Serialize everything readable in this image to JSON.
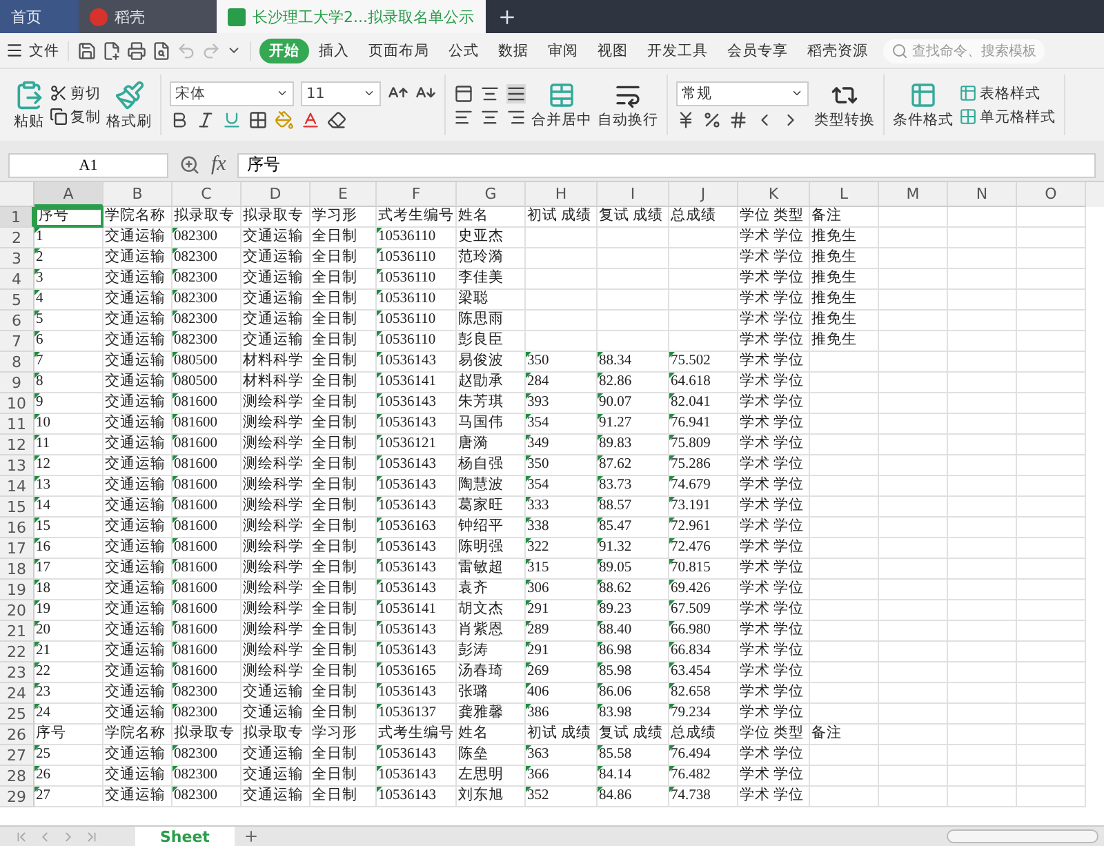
{
  "tabs": [
    {
      "label": "首页",
      "kind": "home",
      "selected": false
    },
    {
      "label": "稻壳",
      "kind": "docer",
      "selected": false
    },
    {
      "label": "长沙理工大学2...拟录取名单公示",
      "kind": "sheet",
      "selected": true
    }
  ],
  "menu": {
    "file": "文件",
    "items": [
      {
        "label": "开始",
        "selected": true
      },
      {
        "label": "插入",
        "selected": false
      },
      {
        "label": "页面布局",
        "selected": false
      },
      {
        "label": "公式",
        "selected": false
      },
      {
        "label": "数据",
        "selected": false
      },
      {
        "label": "审阅",
        "selected": false
      },
      {
        "label": "视图",
        "selected": false
      },
      {
        "label": "开发工具",
        "selected": false
      },
      {
        "label": "会员专享",
        "selected": false
      },
      {
        "label": "稻壳资源",
        "selected": false
      }
    ]
  },
  "search": {
    "placeholder": "查找命令、搜索模板"
  },
  "ribbon": {
    "paste": "粘贴",
    "cut": "剪切",
    "copy": "复制",
    "format_painter": "格式刷",
    "font_name": "宋体",
    "font_size": "11",
    "merge": "合并居中",
    "wrap": "自动换行",
    "number_format": "常规",
    "convert": "类型转换",
    "conditional": "条件格式",
    "table_style": "表格样式",
    "cell_style": "单元格样式"
  },
  "formula_bar": {
    "cell": "A1",
    "fx": "fx",
    "value": "序号"
  },
  "grid": {
    "columns": [
      {
        "label": "A",
        "selected": true,
        "flagged": true
      },
      {
        "label": "B",
        "selected": false
      },
      {
        "label": "C",
        "selected": false,
        "flagged": true
      },
      {
        "label": "D",
        "selected": false
      },
      {
        "label": "E",
        "selected": false
      },
      {
        "label": "F",
        "selected": false,
        "flagged": true
      },
      {
        "label": "G",
        "selected": false
      },
      {
        "label": "H",
        "selected": false,
        "flagged": true
      },
      {
        "label": "I",
        "selected": false,
        "flagged": true
      },
      {
        "label": "J",
        "selected": false,
        "flagged": true
      },
      {
        "label": "K",
        "selected": false
      },
      {
        "label": "L",
        "selected": false
      },
      {
        "label": "M",
        "selected": false
      },
      {
        "label": "N",
        "selected": false
      },
      {
        "label": "O",
        "selected": false
      }
    ],
    "rows": [
      {
        "number": "1",
        "kind": "header",
        "selected": true,
        "cells": [
          "序号",
          "学院名称",
          "拟录取专",
          "拟录取专",
          "学习形",
          "式考生编号",
          "姓名",
          "初试 成绩",
          "复试 成绩",
          "总成绩",
          "学位 类型",
          "备注"
        ]
      },
      {
        "number": "2",
        "kind": "data",
        "selected": false,
        "cells": [
          "1",
          "交通运输",
          "082300",
          "交通运输",
          "全日制",
          "10536110",
          "史亚杰",
          null,
          null,
          null,
          "学术 学位",
          "推免生"
        ]
      },
      {
        "number": "3",
        "kind": "data",
        "selected": false,
        "cells": [
          "2",
          "交通运输",
          "082300",
          "交通运输",
          "全日制",
          "10536110",
          "范玲漪",
          null,
          null,
          null,
          "学术 学位",
          "推免生"
        ]
      },
      {
        "number": "4",
        "kind": "data",
        "selected": false,
        "cells": [
          "3",
          "交通运输",
          "082300",
          "交通运输",
          "全日制",
          "10536110",
          "李佳美",
          null,
          null,
          null,
          "学术 学位",
          "推免生"
        ]
      },
      {
        "number": "5",
        "kind": "data",
        "selected": false,
        "cells": [
          "4",
          "交通运输",
          "082300",
          "交通运输",
          "全日制",
          "10536110",
          "梁聪",
          null,
          null,
          null,
          "学术 学位",
          "推免生"
        ]
      },
      {
        "number": "6",
        "kind": "data",
        "selected": false,
        "cells": [
          "5",
          "交通运输",
          "082300",
          "交通运输",
          "全日制",
          "10536110",
          "陈思雨",
          null,
          null,
          null,
          "学术 学位",
          "推免生"
        ]
      },
      {
        "number": "7",
        "kind": "data",
        "selected": false,
        "cells": [
          "6",
          "交通运输",
          "082300",
          "交通运输",
          "全日制",
          "10536110",
          "彭良臣",
          null,
          null,
          null,
          "学术 学位",
          "推免生"
        ]
      },
      {
        "number": "8",
        "kind": "data",
        "selected": false,
        "cells": [
          "7",
          "交通运输",
          "080500",
          "材料科学",
          "全日制",
          "10536143",
          "易俊波",
          "350",
          "88.34",
          "75.502",
          "学术 学位",
          null
        ]
      },
      {
        "number": "9",
        "kind": "data",
        "selected": false,
        "cells": [
          "8",
          "交通运输",
          "080500",
          "材料科学",
          "全日制",
          "10536141",
          "赵勖承",
          "284",
          "82.86",
          "64.618",
          "学术 学位",
          null
        ]
      },
      {
        "number": "10",
        "kind": "data",
        "selected": false,
        "cells": [
          "9",
          "交通运输",
          "081600",
          "测绘科学",
          "全日制",
          "10536143",
          "朱芳琪",
          "393",
          "90.07",
          "82.041",
          "学术 学位",
          null
        ]
      },
      {
        "number": "11",
        "kind": "data",
        "selected": false,
        "cells": [
          "10",
          "交通运输",
          "081600",
          "测绘科学",
          "全日制",
          "10536143",
          "马国伟",
          "354",
          "91.27",
          "76.941",
          "学术 学位",
          null
        ]
      },
      {
        "number": "12",
        "kind": "data",
        "selected": false,
        "cells": [
          "11",
          "交通运输",
          "081600",
          "测绘科学",
          "全日制",
          "10536121",
          "唐漪",
          "349",
          "89.83",
          "75.809",
          "学术 学位",
          null
        ]
      },
      {
        "number": "13",
        "kind": "data",
        "selected": false,
        "cells": [
          "12",
          "交通运输",
          "081600",
          "测绘科学",
          "全日制",
          "10536143",
          "杨自强",
          "350",
          "87.62",
          "75.286",
          "学术 学位",
          null
        ]
      },
      {
        "number": "14",
        "kind": "data",
        "selected": false,
        "cells": [
          "13",
          "交通运输",
          "081600",
          "测绘科学",
          "全日制",
          "10536143",
          "陶慧波",
          "354",
          "83.73",
          "74.679",
          "学术 学位",
          null
        ]
      },
      {
        "number": "15",
        "kind": "data",
        "selected": false,
        "cells": [
          "14",
          "交通运输",
          "081600",
          "测绘科学",
          "全日制",
          "10536143",
          "葛家旺",
          "333",
          "88.57",
          "73.191",
          "学术 学位",
          null
        ]
      },
      {
        "number": "16",
        "kind": "data",
        "selected": false,
        "cells": [
          "15",
          "交通运输",
          "081600",
          "测绘科学",
          "全日制",
          "10536163",
          "钟绍平",
          "338",
          "85.47",
          "72.961",
          "学术 学位",
          null
        ]
      },
      {
        "number": "17",
        "kind": "data",
        "selected": false,
        "cells": [
          "16",
          "交通运输",
          "081600",
          "测绘科学",
          "全日制",
          "10536143",
          "陈明强",
          "322",
          "91.32",
          "72.476",
          "学术 学位",
          null
        ]
      },
      {
        "number": "18",
        "kind": "data",
        "selected": false,
        "cells": [
          "17",
          "交通运输",
          "081600",
          "测绘科学",
          "全日制",
          "10536143",
          "雷敏超",
          "315",
          "89.05",
          "70.815",
          "学术 学位",
          null
        ]
      },
      {
        "number": "19",
        "kind": "data",
        "selected": false,
        "cells": [
          "18",
          "交通运输",
          "081600",
          "测绘科学",
          "全日制",
          "10536143",
          "袁齐",
          "306",
          "88.62",
          "69.426",
          "学术 学位",
          null
        ]
      },
      {
        "number": "20",
        "kind": "data",
        "selected": false,
        "cells": [
          "19",
          "交通运输",
          "081600",
          "测绘科学",
          "全日制",
          "10536141",
          "胡文杰",
          "291",
          "89.23",
          "67.509",
          "学术 学位",
          null
        ]
      },
      {
        "number": "21",
        "kind": "data",
        "selected": false,
        "cells": [
          "20",
          "交通运输",
          "081600",
          "测绘科学",
          "全日制",
          "10536143",
          "肖紫恩",
          "289",
          "88.40",
          "66.980",
          "学术 学位",
          null
        ]
      },
      {
        "number": "22",
        "kind": "data",
        "selected": false,
        "cells": [
          "21",
          "交通运输",
          "081600",
          "测绘科学",
          "全日制",
          "10536143",
          "彭涛",
          "291",
          "86.98",
          "66.834",
          "学术 学位",
          null
        ]
      },
      {
        "number": "23",
        "kind": "data",
        "selected": false,
        "cells": [
          "22",
          "交通运输",
          "081600",
          "测绘科学",
          "全日制",
          "10536165",
          "汤春琦",
          "269",
          "85.98",
          "63.454",
          "学术 学位",
          null
        ]
      },
      {
        "number": "24",
        "kind": "data",
        "selected": false,
        "cells": [
          "23",
          "交通运输",
          "082300",
          "交通运输",
          "全日制",
          "10536143",
          "张璐",
          "406",
          "86.06",
          "82.658",
          "学术 学位",
          null
        ]
      },
      {
        "number": "25",
        "kind": "data",
        "selected": false,
        "cells": [
          "24",
          "交通运输",
          "082300",
          "交通运输",
          "全日制",
          "10536137",
          "龚雅馨",
          "386",
          "83.98",
          "79.234",
          "学术 学位",
          null
        ]
      },
      {
        "number": "26",
        "kind": "header",
        "selected": false,
        "cells": [
          "序号",
          "学院名称",
          "拟录取专",
          "拟录取专",
          "学习形",
          "式考生编号",
          "姓名",
          "初试 成绩",
          "复试 成绩",
          "总成绩",
          "学位 类型",
          "备注"
        ]
      },
      {
        "number": "27",
        "kind": "data",
        "selected": false,
        "cells": [
          "25",
          "交通运输",
          "082300",
          "交通运输",
          "全日制",
          "10536143",
          "陈垒",
          "363",
          "85.58",
          "76.494",
          "学术 学位",
          null
        ]
      },
      {
        "number": "28",
        "kind": "data",
        "selected": false,
        "cells": [
          "26",
          "交通运输",
          "082300",
          "交通运输",
          "全日制",
          "10536143",
          "左思明",
          "366",
          "84.14",
          "76.482",
          "学术 学位",
          null
        ]
      },
      {
        "number": "29",
        "kind": "data",
        "selected": false,
        "cells": [
          "27",
          "交通运输",
          "082300",
          "交通运输",
          "全日制",
          "10536143",
          "刘东旭",
          "352",
          "84.86",
          "74.738",
          "学术 学位",
          null
        ]
      }
    ]
  },
  "sheet_tabs": [
    {
      "label": "Sheet",
      "selected": true
    }
  ]
}
